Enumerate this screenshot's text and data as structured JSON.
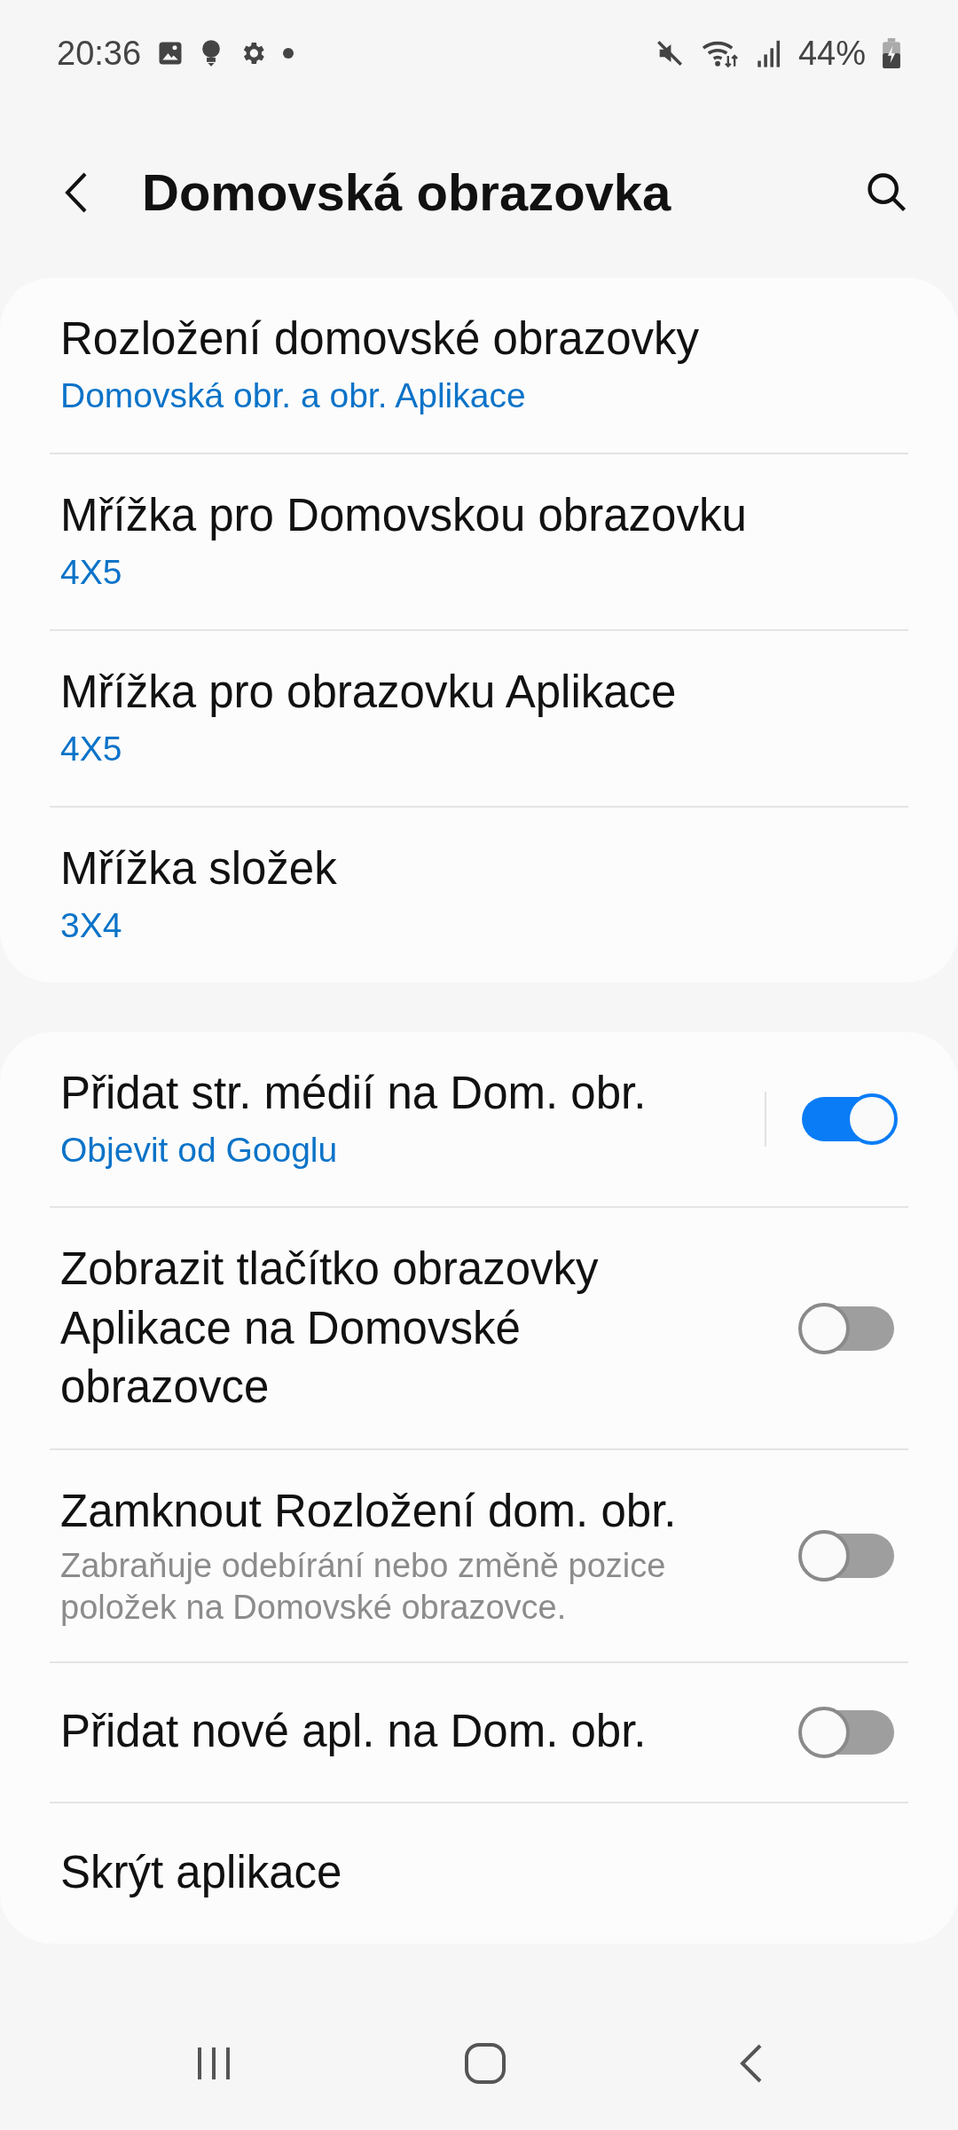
{
  "status_bar": {
    "time": "20:36",
    "battery": "44%"
  },
  "header": {
    "title": "Domovská obrazovka"
  },
  "groups": [
    {
      "items": [
        {
          "kind": "nav",
          "title": "Rozložení domovské obrazovky",
          "value": "Domovská obr. a obr. Aplikace"
        },
        {
          "kind": "nav",
          "title": "Mřížka pro Domovskou obrazovku",
          "value": "4X5"
        },
        {
          "kind": "nav",
          "title": "Mřížka pro obrazovku Aplikace",
          "value": "4X5"
        },
        {
          "kind": "nav",
          "title": "Mřížka složek",
          "value": "3X4"
        }
      ]
    },
    {
      "items": [
        {
          "kind": "link-switch",
          "title": "Přidat str. médií na Dom. obr.",
          "value": "Objevit od Googlu",
          "on": true
        },
        {
          "kind": "switch",
          "title": "Zobrazit tlačítko obrazovky Aplikace na Domovské obrazovce",
          "on": false
        },
        {
          "kind": "switch",
          "title": "Zamknout Rozložení dom. obr.",
          "description": "Zabraňuje odebírání nebo změně pozice položek na Domovské obrazovce.",
          "on": false
        },
        {
          "kind": "switch",
          "title": "Přidat nové apl. na Dom. obr.",
          "on": false
        },
        {
          "kind": "nav",
          "title": "Skrýt aplikace"
        }
      ]
    }
  ]
}
